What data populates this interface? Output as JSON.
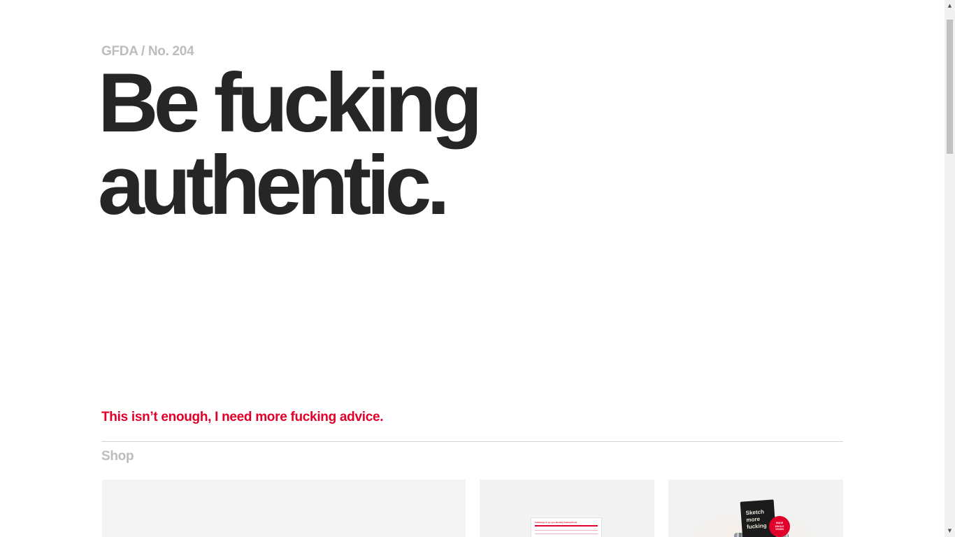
{
  "header": {
    "kicker": "GFDA / No. 204"
  },
  "main": {
    "headline_line1": "Be fucking",
    "headline_line2": "authentic.",
    "more_advice_link": "This isn’t enough, I need more fucking advice."
  },
  "shop": {
    "label": "Shop",
    "cards": [
      {
        "name": "shop-item-1"
      },
      {
        "name": "shop-item-2",
        "poster_title": "Letterings to go you already fucking know"
      },
      {
        "name": "shop-item-3",
        "notebook_text": "Sketch\nmore\nfucking",
        "sticker_text": "MADE\nWHOLE\nVISION"
      }
    ]
  },
  "scrollbar": {
    "up_icon": "▲",
    "down_icon": "▼"
  }
}
